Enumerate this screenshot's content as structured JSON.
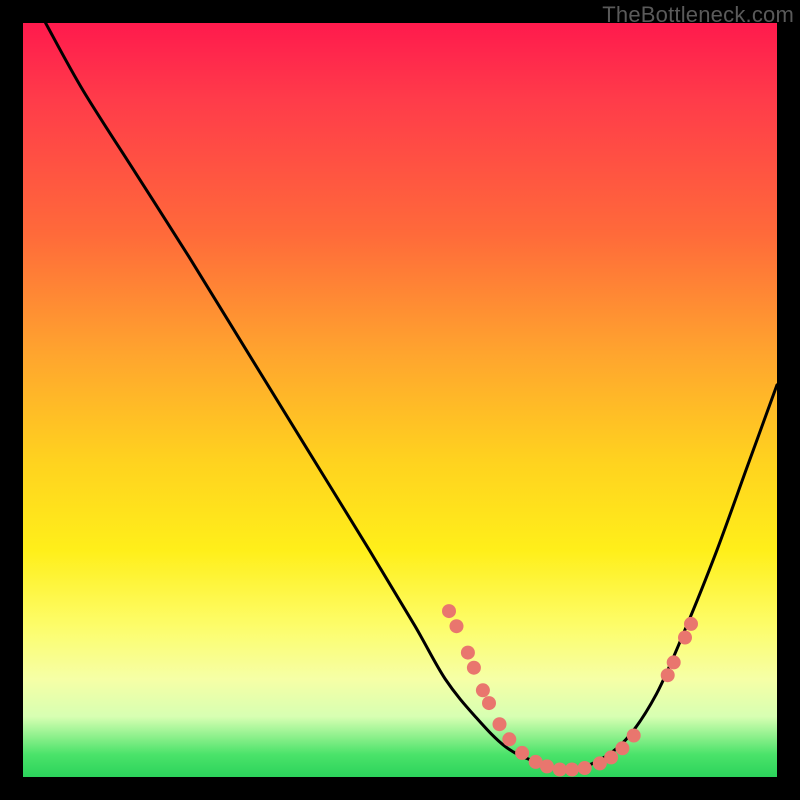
{
  "watermark": "TheBottleneck.com",
  "colors": {
    "frame": "#000000",
    "curve": "#000000",
    "dot": "#e9766e"
  },
  "chart_data": {
    "type": "line",
    "title": "",
    "xlabel": "",
    "ylabel": "",
    "xlim": [
      0,
      100
    ],
    "ylim": [
      0,
      100
    ],
    "grid": false,
    "legend": false,
    "series": [
      {
        "name": "bottleneck-curve",
        "x": [
          3,
          8,
          15,
          22,
          30,
          38,
          46,
          52,
          56,
          60,
          64,
          68,
          72,
          76,
          80,
          84,
          88,
          92,
          96,
          100
        ],
        "y": [
          100,
          91,
          80,
          69,
          56,
          43,
          30,
          20,
          13,
          8,
          4,
          2,
          1,
          2,
          5,
          11,
          20,
          30,
          41,
          52
        ]
      }
    ],
    "points": [
      {
        "x": 56.5,
        "y": 22.0
      },
      {
        "x": 57.5,
        "y": 20.0
      },
      {
        "x": 59.0,
        "y": 16.5
      },
      {
        "x": 59.8,
        "y": 14.5
      },
      {
        "x": 61.0,
        "y": 11.5
      },
      {
        "x": 61.8,
        "y": 9.8
      },
      {
        "x": 63.2,
        "y": 7.0
      },
      {
        "x": 64.5,
        "y": 5.0
      },
      {
        "x": 66.2,
        "y": 3.2
      },
      {
        "x": 68.0,
        "y": 2.0
      },
      {
        "x": 69.5,
        "y": 1.4
      },
      {
        "x": 71.2,
        "y": 1.0
      },
      {
        "x": 72.8,
        "y": 1.0
      },
      {
        "x": 74.5,
        "y": 1.2
      },
      {
        "x": 76.5,
        "y": 1.8
      },
      {
        "x": 78.0,
        "y": 2.6
      },
      {
        "x": 79.5,
        "y": 3.8
      },
      {
        "x": 81.0,
        "y": 5.5
      },
      {
        "x": 85.5,
        "y": 13.5
      },
      {
        "x": 86.3,
        "y": 15.2
      },
      {
        "x": 87.8,
        "y": 18.5
      },
      {
        "x": 88.6,
        "y": 20.3
      }
    ]
  }
}
